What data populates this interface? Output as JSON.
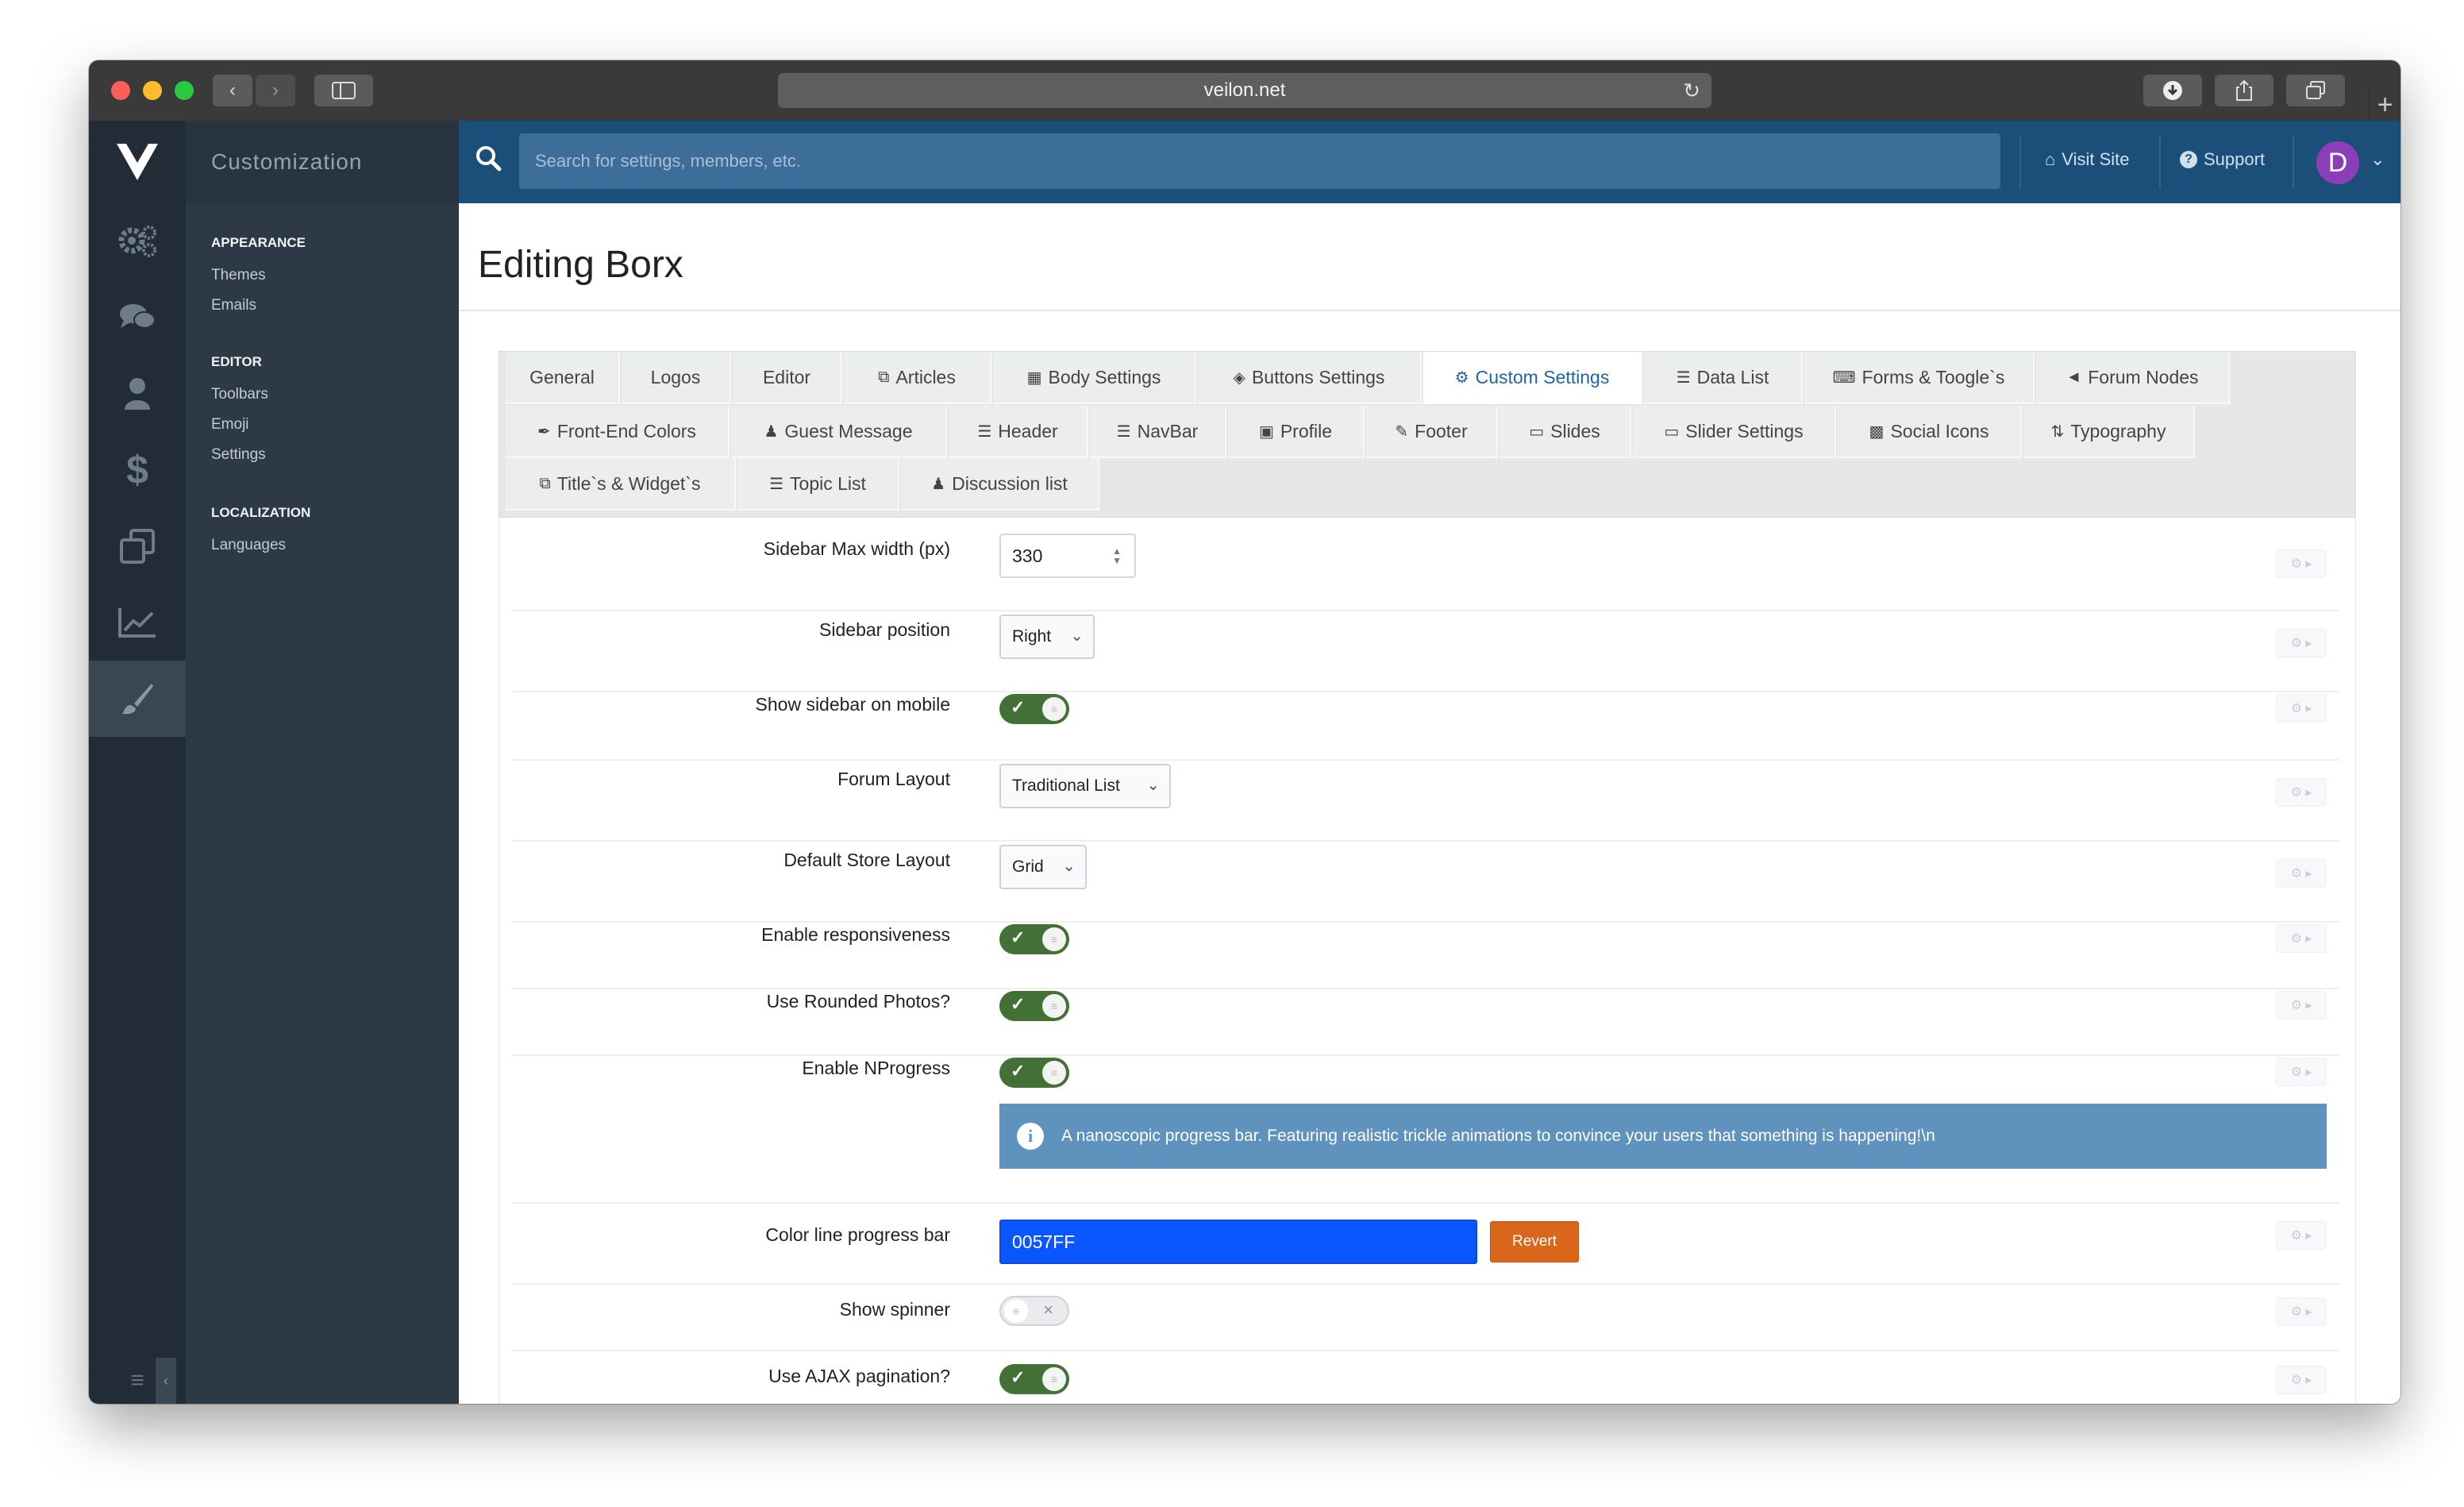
{
  "browser": {
    "url": "veilon.net"
  },
  "sidebar": {
    "title": "Customization",
    "sections": [
      {
        "heading": "APPEARANCE",
        "links": [
          "Themes",
          "Emails"
        ]
      },
      {
        "heading": "EDITOR",
        "links": [
          "Toolbars",
          "Emoji",
          "Settings"
        ]
      },
      {
        "heading": "LOCALIZATION",
        "links": [
          "Languages"
        ]
      }
    ]
  },
  "header": {
    "search_placeholder": "Search for settings, members, etc.",
    "visit_site": "Visit Site",
    "support": "Support",
    "avatar_initial": "D"
  },
  "page": {
    "title": "Editing Borx"
  },
  "tabs": {
    "row1": [
      "General",
      "Logos",
      "Editor",
      "Articles",
      "Body Settings",
      "Buttons Settings",
      "Custom Settings",
      "Data List",
      "Forms & Toogle`s",
      "Forum Nodes"
    ],
    "row2": [
      "Front-End Colors",
      "Guest Message",
      "Header",
      "NavBar",
      "Profile",
      "Footer",
      "Slides",
      "Slider Settings",
      "Social Icons",
      "Typography"
    ],
    "row3": [
      "Title`s & Widget`s",
      "Topic List",
      "Discussion list"
    ],
    "active": "Custom Settings"
  },
  "settings": {
    "sidebar_max_width": {
      "label": "Sidebar Max width (px)",
      "value": "330"
    },
    "sidebar_position": {
      "label": "Sidebar position",
      "value": "Right"
    },
    "show_sidebar_mobile": {
      "label": "Show sidebar on mobile",
      "enabled": true
    },
    "forum_layout": {
      "label": "Forum Layout",
      "value": "Traditional List"
    },
    "store_layout": {
      "label": "Default Store Layout",
      "value": "Grid"
    },
    "responsiveness": {
      "label": "Enable responsiveness",
      "enabled": true
    },
    "rounded_photos": {
      "label": "Use Rounded Photos?",
      "enabled": true
    },
    "nprogress": {
      "label": "Enable NProgress",
      "enabled": true,
      "info": "A nanoscopic progress bar. Featuring realistic trickle animations to convince your users that something is happening!\\n"
    },
    "progress_color": {
      "label": "Color line progress bar",
      "value": "0057FF",
      "revert": "Revert",
      "swatch": "#0a57ff"
    },
    "spinner": {
      "label": "Show spinner",
      "enabled": false
    },
    "ajax_pagination": {
      "label": "Use AJAX pagination?",
      "enabled": true
    }
  },
  "colors": {
    "header_bg": "#1c4e7a",
    "toggle_on": "#437034",
    "accent": "#1f63a8",
    "revert": "#d9661a",
    "avatar": "#8c3eb8"
  }
}
